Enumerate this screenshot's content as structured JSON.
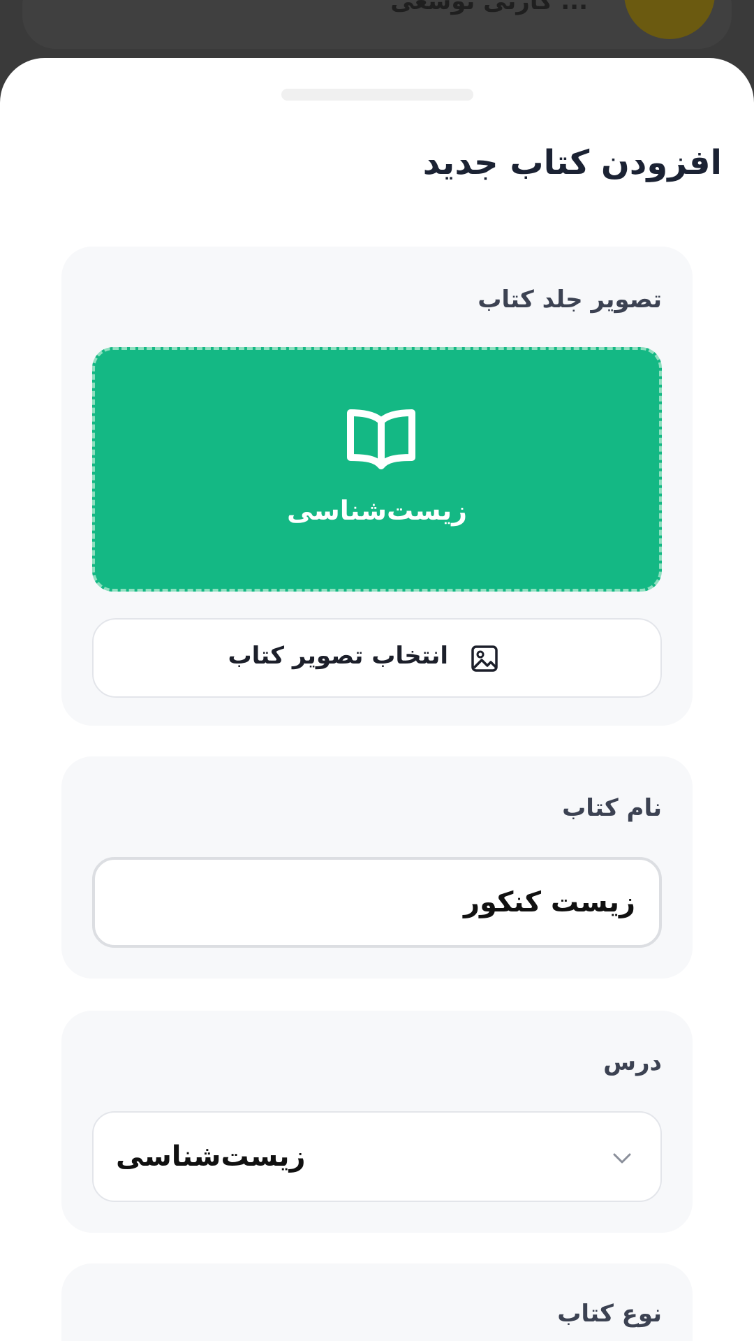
{
  "background": {
    "card_text": "... کارتی توسعی"
  },
  "sheet": {
    "title": "افزودن کتاب جدید"
  },
  "cover": {
    "label": "تصویر جلد کتاب",
    "preview_text": "زیست‌شناسی",
    "preview_icon": "open-book-icon",
    "preview_color": "#14b884",
    "pick_button_label": "انتخاب تصویر کتاب",
    "pick_button_icon": "image-icon"
  },
  "name": {
    "label": "نام کتاب",
    "value": "زیست کنکور"
  },
  "subject": {
    "label": "درس",
    "selected": "زیست‌شناسی",
    "icon": "chevron-down-icon"
  },
  "type": {
    "label": "نوع کتاب"
  }
}
